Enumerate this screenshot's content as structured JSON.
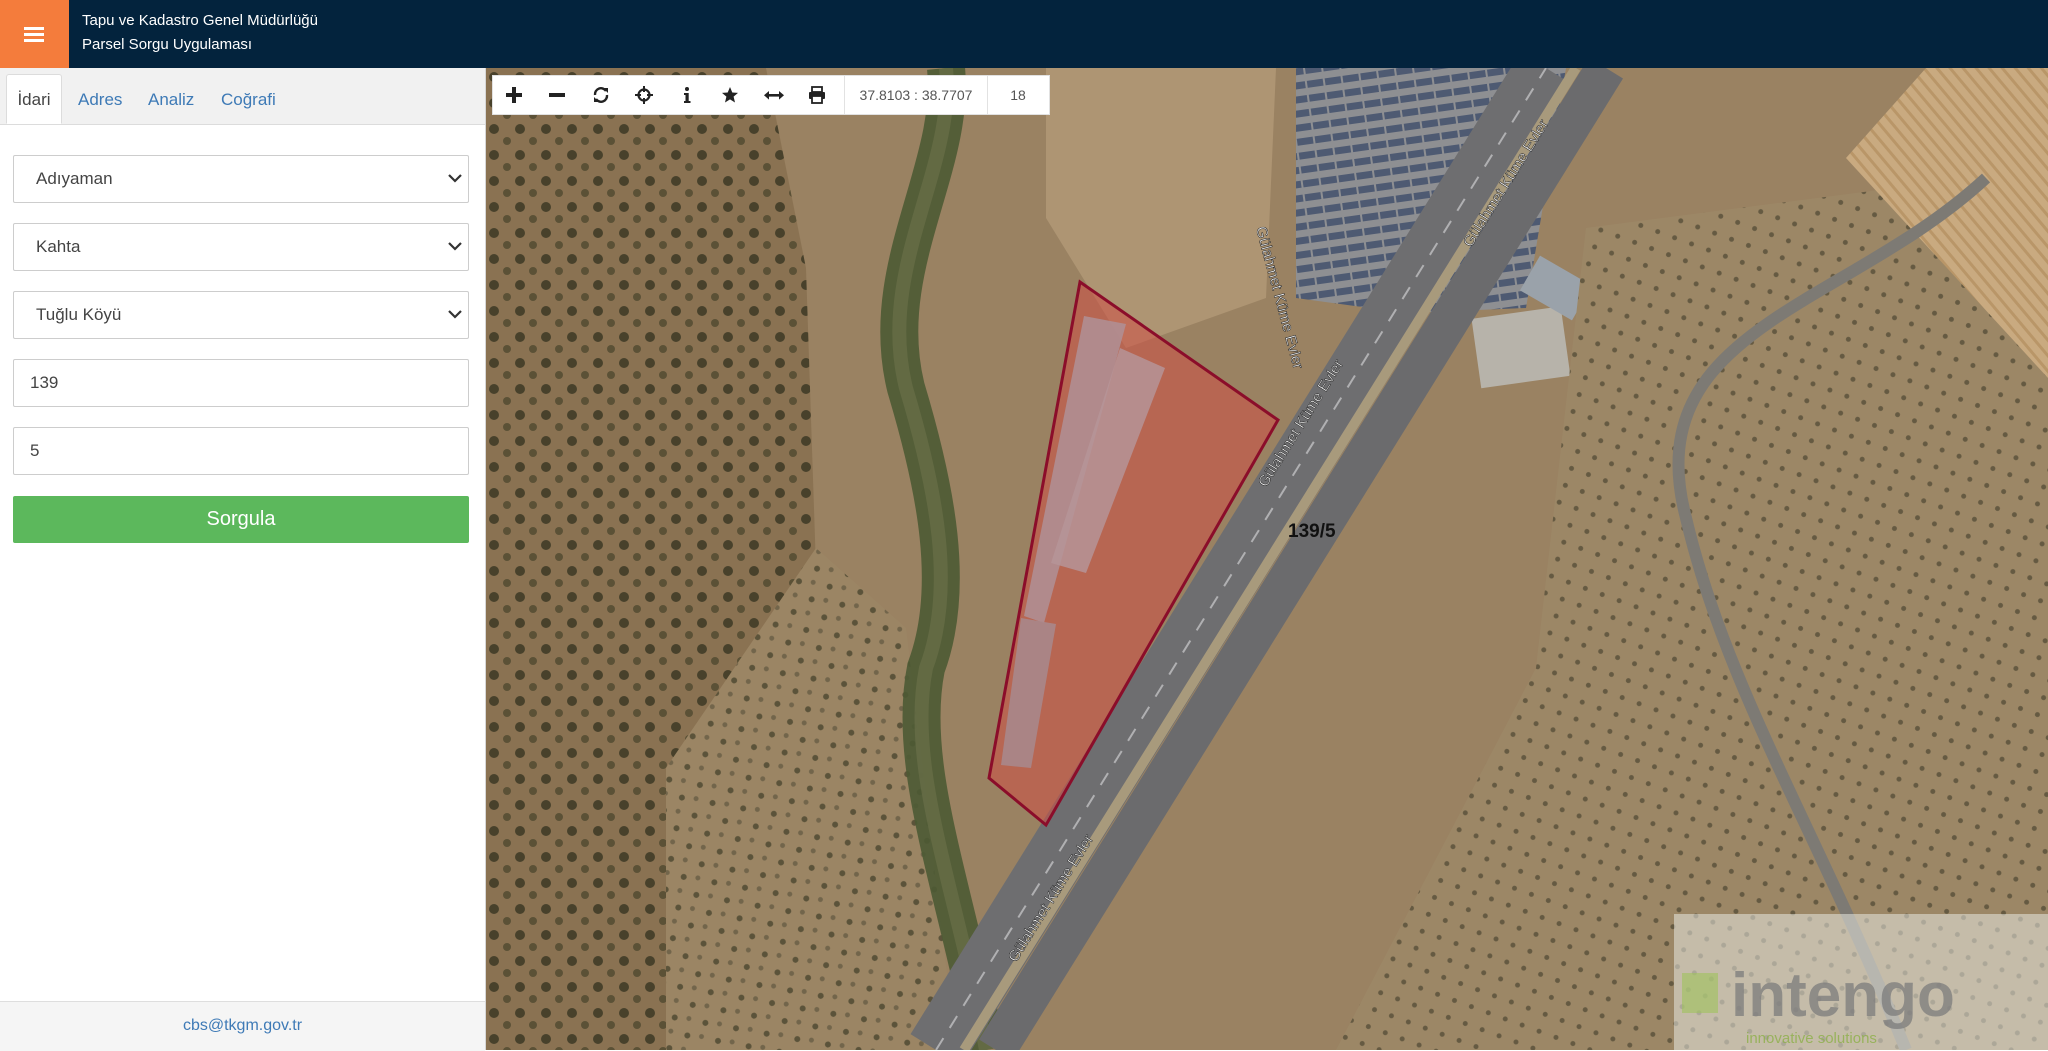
{
  "header": {
    "title_line1": "Tapu ve Kadastro Genel Müdürlüğü",
    "title_line2": "Parsel Sorgu Uygulaması",
    "menu_icon": "hamburger-icon",
    "accent_color": "#f47c3c",
    "bar_color": "#03233d"
  },
  "tabs": [
    {
      "label": "İdari",
      "active": true
    },
    {
      "label": "Adres",
      "active": false
    },
    {
      "label": "Analiz",
      "active": false
    },
    {
      "label": "Coğrafi",
      "active": false
    }
  ],
  "form": {
    "province": "Adıyaman",
    "district": "Kahta",
    "neighborhood": "Tuğlu Köyü",
    "block": "139",
    "parcel": "5",
    "submit_label": "Sorgula",
    "submit_color": "#5cb85c"
  },
  "footer": {
    "email": "cbs@tkgm.gov.tr"
  },
  "map_toolbar": {
    "tools": [
      "zoom-in-icon",
      "zoom-out-icon",
      "refresh-icon",
      "locate-icon",
      "info-icon",
      "favorite-icon",
      "measure-icon",
      "print-icon"
    ],
    "coordinates": "37.8103 : 38.7707",
    "zoom_level": "18"
  },
  "map": {
    "parcel_label": "139/5",
    "parcel_color": "#8b0d2a",
    "road_labels": [
      "Gülahmet Küme Evler",
      "Gülahmet Küme Evler",
      "Gülahmet Küme Evler",
      "Gülahmet Küme Evler"
    ],
    "watermark": {
      "brand": "intengo",
      "tagline": "innovative solutions"
    }
  }
}
